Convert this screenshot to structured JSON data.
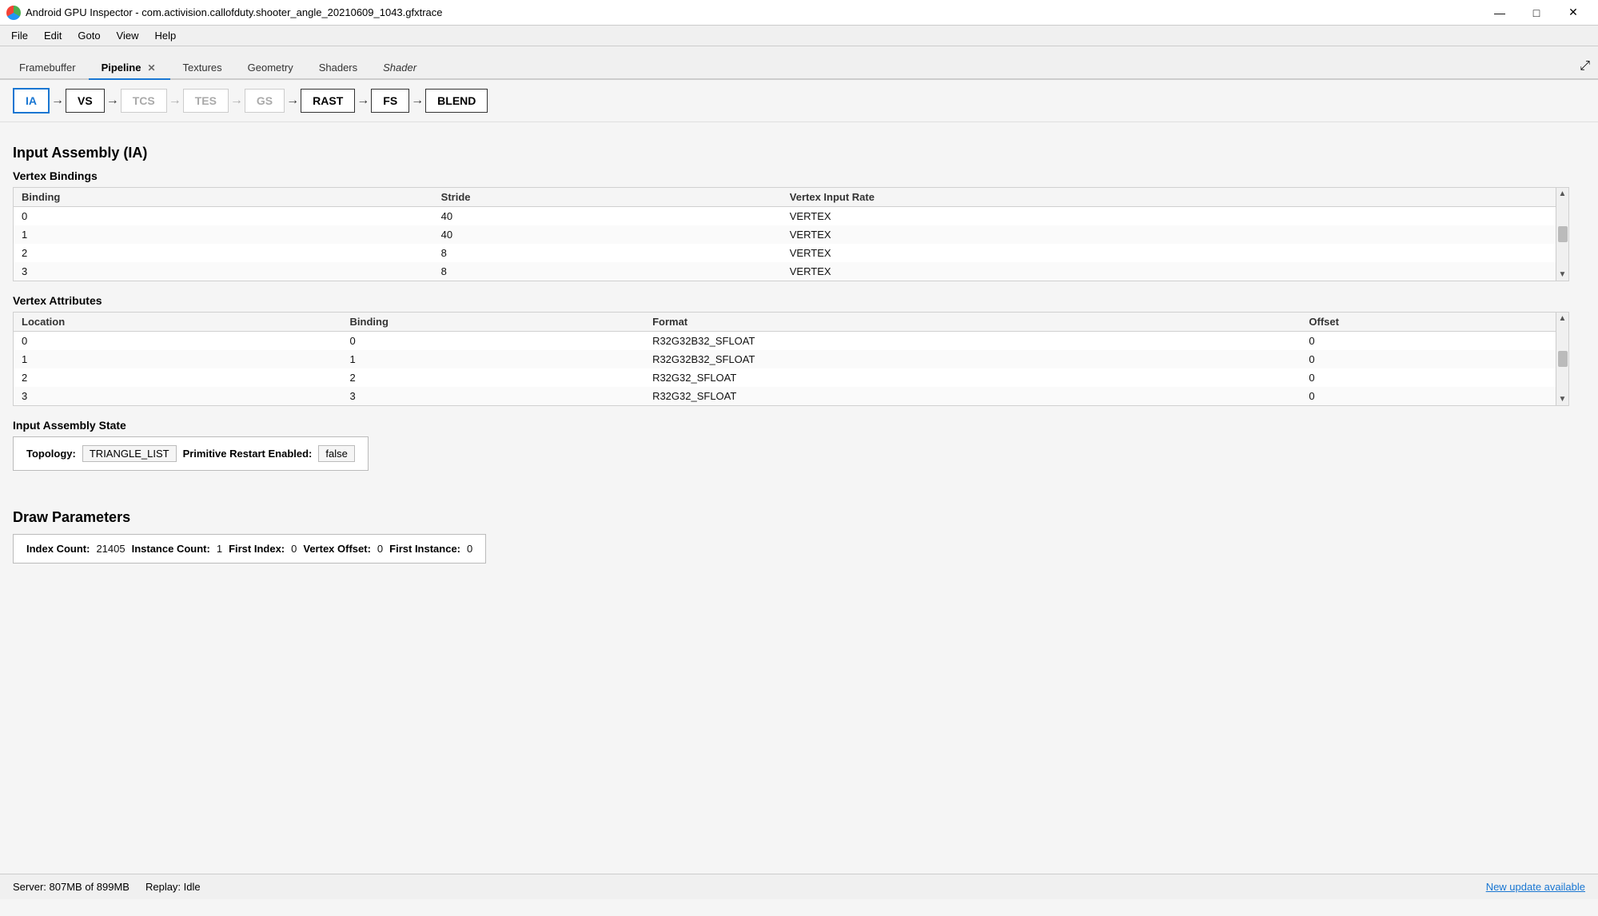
{
  "titleBar": {
    "title": "Android GPU Inspector - com.activision.callofduty.shooter_angle_20210609_1043.gfxtrace",
    "minBtn": "—",
    "maxBtn": "□",
    "closeBtn": "✕"
  },
  "menuBar": {
    "items": [
      "File",
      "Edit",
      "Goto",
      "View",
      "Help"
    ]
  },
  "tabs": [
    {
      "id": "framebuffer",
      "label": "Framebuffer",
      "active": false,
      "italic": false,
      "closeable": false
    },
    {
      "id": "pipeline",
      "label": "Pipeline",
      "active": true,
      "italic": false,
      "closeable": true
    },
    {
      "id": "textures",
      "label": "Textures",
      "active": false,
      "italic": false,
      "closeable": false
    },
    {
      "id": "geometry",
      "label": "Geometry",
      "active": false,
      "italic": false,
      "closeable": false
    },
    {
      "id": "shaders",
      "label": "Shaders",
      "active": false,
      "italic": false,
      "closeable": false
    },
    {
      "id": "shader",
      "label": "Shader",
      "active": false,
      "italic": true,
      "closeable": false
    }
  ],
  "pipeline": {
    "stages": [
      {
        "id": "IA",
        "label": "IA",
        "active": true,
        "disabled": false
      },
      {
        "id": "VS",
        "label": "VS",
        "active": false,
        "disabled": false
      },
      {
        "id": "TCS",
        "label": "TCS",
        "active": false,
        "disabled": true
      },
      {
        "id": "TES",
        "label": "TES",
        "active": false,
        "disabled": true
      },
      {
        "id": "GS",
        "label": "GS",
        "active": false,
        "disabled": true
      },
      {
        "id": "RAST",
        "label": "RAST",
        "active": false,
        "disabled": false
      },
      {
        "id": "FS",
        "label": "FS",
        "active": false,
        "disabled": false
      },
      {
        "id": "BLEND",
        "label": "BLEND",
        "active": false,
        "disabled": false
      }
    ]
  },
  "inputAssembly": {
    "sectionTitle": "Input Assembly (IA)",
    "vertexBindings": {
      "title": "Vertex Bindings",
      "columns": [
        "Binding",
        "Stride",
        "Vertex Input Rate"
      ],
      "rows": [
        [
          "0",
          "40",
          "VERTEX"
        ],
        [
          "1",
          "40",
          "VERTEX"
        ],
        [
          "2",
          "8",
          "VERTEX"
        ],
        [
          "3",
          "8",
          "VERTEX"
        ]
      ]
    },
    "vertexAttributes": {
      "title": "Vertex Attributes",
      "columns": [
        "Location",
        "Binding",
        "Format",
        "Offset"
      ],
      "rows": [
        [
          "0",
          "0",
          "R32G32B32_SFLOAT",
          "0"
        ],
        [
          "1",
          "1",
          "R32G32B32_SFLOAT",
          "0"
        ],
        [
          "2",
          "2",
          "R32G32_SFLOAT",
          "0"
        ],
        [
          "3",
          "3",
          "R32G32_SFLOAT",
          "0"
        ]
      ]
    },
    "inputAssemblyState": {
      "title": "Input Assembly State",
      "topologyLabel": "Topology:",
      "topologyValue": "TRIANGLE_LIST",
      "primitiveRestartLabel": "Primitive Restart Enabled:",
      "primitiveRestartValue": "false"
    }
  },
  "drawParameters": {
    "title": "Draw Parameters",
    "indexCountLabel": "Index Count:",
    "indexCountValue": "21405",
    "instanceCountLabel": "Instance Count:",
    "instanceCountValue": "1",
    "firstIndexLabel": "First Index:",
    "firstIndexValue": "0",
    "vertexOffsetLabel": "Vertex Offset:",
    "vertexOffsetValue": "0",
    "firstInstanceLabel": "First Instance:",
    "firstInstanceValue": "0"
  },
  "statusBar": {
    "server": "Server: 807MB of 899MB",
    "replay": "Replay: Idle",
    "updateText": "New update available"
  }
}
